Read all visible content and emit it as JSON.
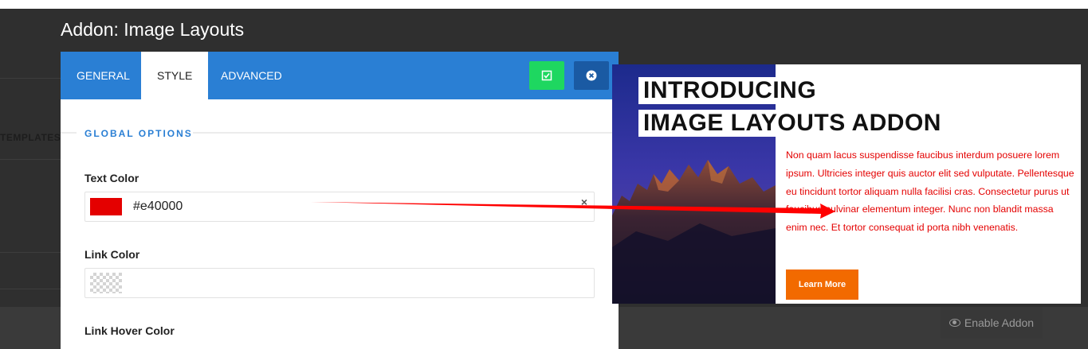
{
  "page": {
    "title": "Addon: Image Layouts"
  },
  "background": {
    "templates_label": "TEMPLATES",
    "enable_addon_label": "Enable Addon"
  },
  "modal": {
    "tabs": [
      {
        "label": "GENERAL",
        "active": false
      },
      {
        "label": "STYLE",
        "active": true
      },
      {
        "label": "ADVANCED",
        "active": false
      }
    ],
    "buttons": {
      "apply_icon": "checkbox-check-icon",
      "close_icon": "close-circle-icon"
    },
    "section_title": "GLOBAL OPTIONS",
    "fields": {
      "text_color": {
        "label": "Text Color",
        "value": "#e40000",
        "swatch": "#e40000"
      },
      "link_color": {
        "label": "Link Color",
        "value": ""
      },
      "link_hover_color": {
        "label": "Link Hover Color"
      }
    }
  },
  "preview": {
    "headline_line1": "INTRODUCING",
    "headline_line2": "IMAGE LAYOUTS ADDON",
    "body": "Non quam lacus suspendisse faucibus interdum posuere lorem ipsum. Ultricies integer quis auctor elit sed vulputate. Pellentesque eu tincidunt tortor aliquam nulla facilisi cras. Consectetur purus ut faucibus pulvinar elementum integer. Nunc non blandit massa enim nec. Et tortor consequat id porta nibh venenatis.",
    "button_label": "Learn More",
    "text_color": "#e40000",
    "button_color": "#f26a00"
  },
  "colors": {
    "accent": "#2a7fd4",
    "apply_button": "#1ed760",
    "close_button": "#1a5aa3",
    "arrow": "#ff0000"
  }
}
